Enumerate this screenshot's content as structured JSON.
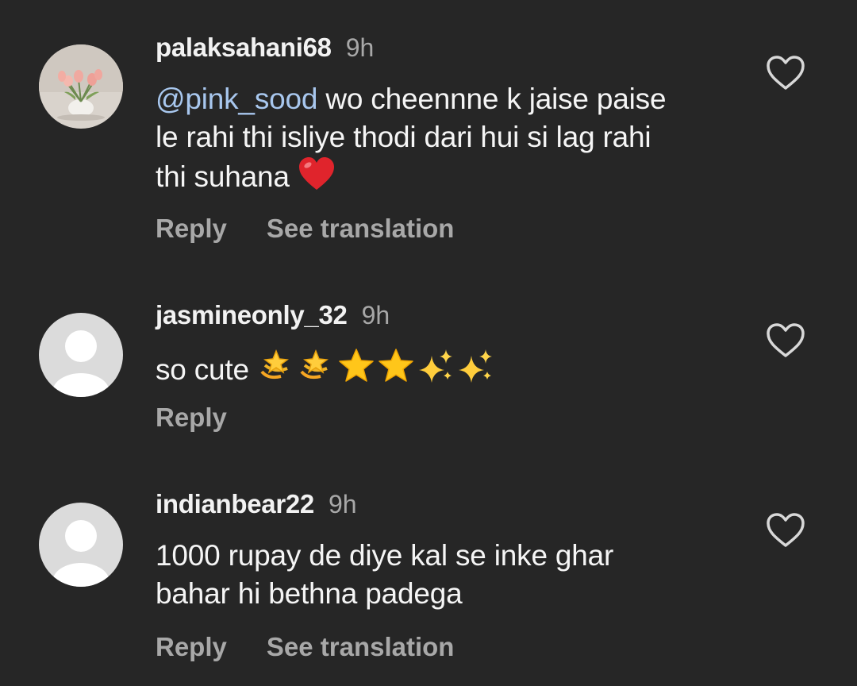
{
  "comments": [
    {
      "username": "palaksahani68",
      "time": "9h",
      "mention": "@pink_sood",
      "line1": " wo cheennne k jaise paise",
      "line2": "le rahi thi isliye thodi dari hui si lag rahi",
      "line3": "thi suhana ",
      "emoji": "heart-emoji",
      "avatar": "tulip-lamp-photo",
      "actions": {
        "reply": "Reply",
        "translate": "See translation"
      }
    },
    {
      "username": "jasmineonly_32",
      "time": "9h",
      "text": "so cute ",
      "emojis": [
        "dizzy-emoji",
        "dizzy-emoji",
        "star-emoji",
        "star-emoji",
        "sparkles-emoji",
        "sparkles-emoji"
      ],
      "avatar": "default-avatar",
      "actions": {
        "reply": "Reply"
      }
    },
    {
      "username": "indianbear22",
      "time": "9h",
      "line1": "1000 rupay de diye kal se inke ghar",
      "line2": "bahar hi bethna padega",
      "avatar": "default-avatar",
      "actions": {
        "reply": "Reply",
        "translate": "See translation"
      }
    }
  ],
  "icons": {
    "like": "heart-outline-icon"
  },
  "colors": {
    "background": "#262626",
    "text": "#f5f5f5",
    "secondary": "#a8a8a8",
    "mention": "#a8c7ee"
  }
}
